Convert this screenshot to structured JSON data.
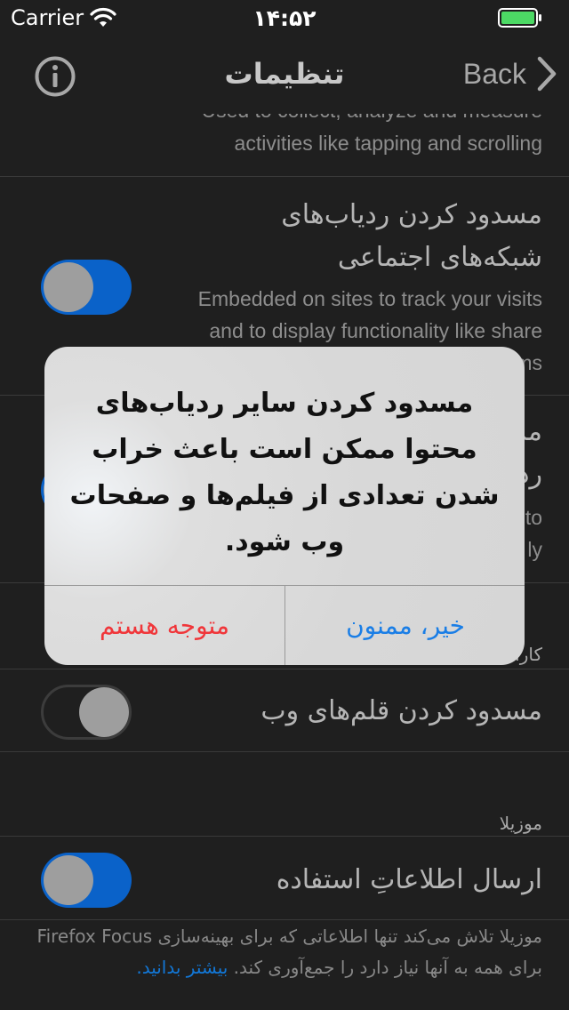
{
  "status_bar": {
    "carrier": "Carrier",
    "time": "۱۴:۵۲",
    "battery_color": "#4cd964"
  },
  "nav": {
    "title": "تنظیمات",
    "back_label": "Back",
    "info_icon": "info-circle-icon"
  },
  "settings": {
    "analytics_desc_partial": "Used to collect, analyze and measure",
    "analytics_desc_line2": "activities like tapping and scrolling",
    "social_title_line1": "مسدود کردن ردیاب‌های",
    "social_title_line2": "شبکه‌های اجتماعی",
    "social_desc_line1": "Embedded on sites to track your visits",
    "social_desc_line2": "and to display functionality like share",
    "social_desc_line3_partial": "ms",
    "social_toggle_on": true,
    "other_title_partial_1": "مد",
    "other_title_partial_2": "رد",
    "other_desc_partial_1": "to",
    "other_desc_partial_2": "ly",
    "performance_header_partial": "کارا",
    "web_fonts_title": "مسدود کردن قلم‌های وب",
    "web_fonts_toggle_on": false,
    "mozilla_header": "موزیلا",
    "usage_data_title": "ارسال اطلاعاتِ استفاده",
    "usage_toggle_on": true,
    "footer_text": "موزیلا تلاش می‌کند تنها اطلاعاتی که برای بهینه‌سازی Firefox Focus برای همه به آنها نیاز دارد را جمع‌آوری کند.",
    "learn_more": "بیشتر بدانید."
  },
  "alert": {
    "message": "مسدود کردن سایر ردیاب‌های محتوا ممکن است باعث خراب شدن تعدادی از فیلم‌ها و صفحات وب شود.",
    "confirm_label": "متوجه هستم",
    "decline_label": "خیر، ممنون",
    "confirm_color": "#f0363a",
    "decline_color": "#1a7ee6"
  }
}
